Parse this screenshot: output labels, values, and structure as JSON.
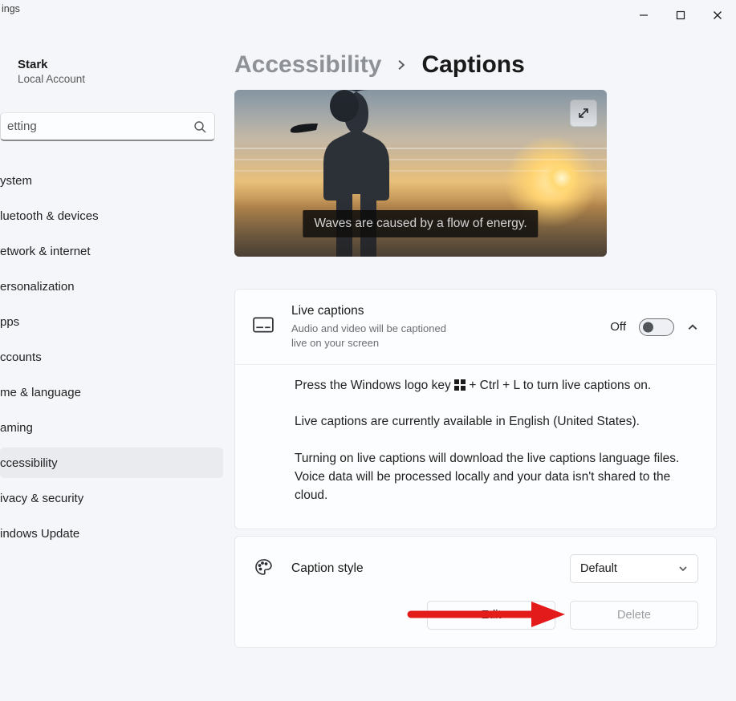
{
  "titlebar": {
    "fragment": "ings"
  },
  "account": {
    "name": "Stark",
    "sub": "Local Account"
  },
  "search": {
    "value": "etting"
  },
  "nav": [
    {
      "label": "ystem"
    },
    {
      "label": "luetooth & devices"
    },
    {
      "label": "etwork & internet"
    },
    {
      "label": "ersonalization"
    },
    {
      "label": "pps"
    },
    {
      "label": "ccounts"
    },
    {
      "label": "me & language"
    },
    {
      "label": "aming"
    },
    {
      "label": "ccessibility",
      "selected": true
    },
    {
      "label": "ivacy & security"
    },
    {
      "label": "indows Update"
    }
  ],
  "breadcrumb": {
    "parent": "Accessibility",
    "current": "Captions"
  },
  "preview": {
    "caption_text": "Waves are caused by a flow of energy."
  },
  "live_captions": {
    "title": "Live captions",
    "sub": "Audio and video will be captioned live on your screen",
    "state_label": "Off",
    "body": {
      "p1a": "Press the Windows logo key ",
      "p1b": " + Ctrl + L to turn live captions on.",
      "p2": "Live captions are currently available in English (United States).",
      "p3": "Turning on live captions will download the live captions language files. Voice data will be processed locally and your data isn't shared to the cloud."
    }
  },
  "caption_style": {
    "title": "Caption style",
    "selected": "Default",
    "edit": "Edit",
    "delete": "Delete"
  }
}
